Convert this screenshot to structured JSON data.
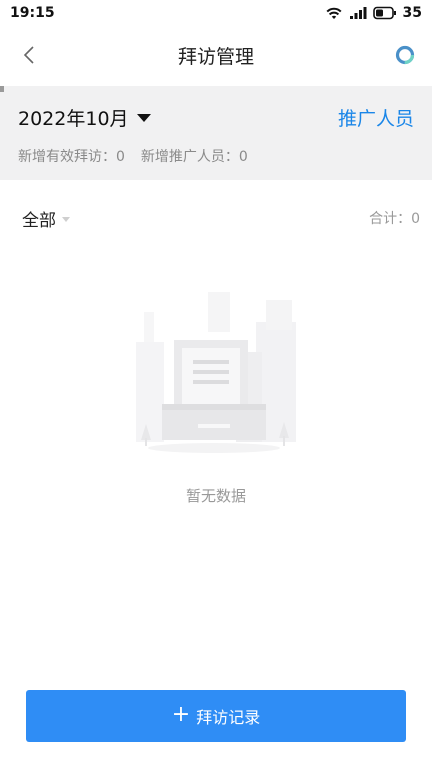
{
  "status_bar": {
    "time": "19:15",
    "battery": "35"
  },
  "nav": {
    "title": "拜访管理"
  },
  "filter": {
    "month": "2022年10月",
    "promoter_label": "推广人员",
    "stat_visits": "新增有效拜访：0",
    "stat_promoters": "新增推广人员：0"
  },
  "list_header": {
    "scope": "全部",
    "total": "合计：0"
  },
  "empty": {
    "text": "暂无数据"
  },
  "footer": {
    "plus": "+",
    "add_label": "拜访记录"
  },
  "colors": {
    "accent": "#2f8df5",
    "link": "#1a86e8",
    "panel": "#f1f1f2"
  }
}
